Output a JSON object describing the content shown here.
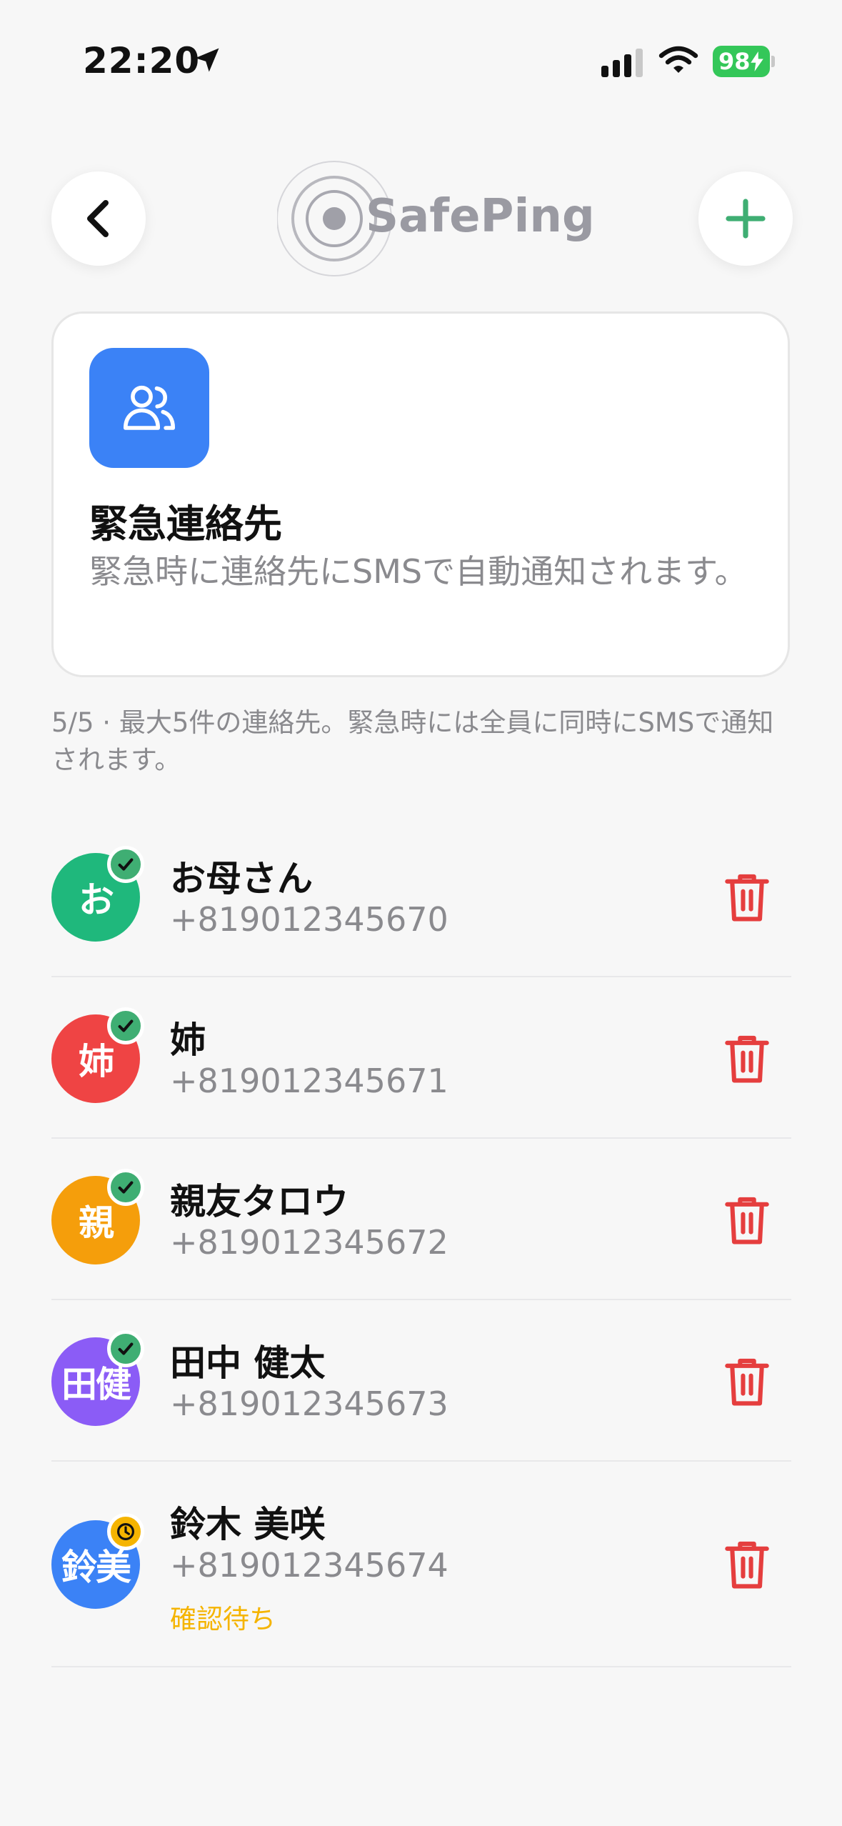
{
  "status_bar": {
    "time": "22:20",
    "battery": "98"
  },
  "header": {
    "logo_text": "SafePing"
  },
  "info_card": {
    "title": "緊急連絡先",
    "description": "緊急時に連絡先にSMSで自動通知されます。"
  },
  "summary": "5/5 · 最大5件の連絡先。緊急時には全員に同時にSMSで通知されます。",
  "contacts": [
    {
      "initial": "お",
      "name": "お母さん",
      "phone": "+819012345670",
      "color": "#1fb87c",
      "verified": true
    },
    {
      "initial": "姉",
      "name": "姉",
      "phone": "+819012345671",
      "color": "#ef4444",
      "verified": true
    },
    {
      "initial": "親",
      "name": "親友タロウ",
      "phone": "+819012345672",
      "color": "#f59e0b",
      "verified": true
    },
    {
      "initial": "田健",
      "name": "田中 健太",
      "phone": "+819012345673",
      "color": "#8b5cf6",
      "verified": true
    },
    {
      "initial": "鈴美",
      "name": "鈴木 美咲",
      "phone": "+819012345674",
      "color": "#3b82f6",
      "verified": false,
      "status": "確認待ち"
    }
  ],
  "colors": {
    "accent_green": "#3fae73",
    "delete_red": "#e53e3e",
    "pending_yellow": "#f5b400",
    "card_icon_blue": "#3b82f6"
  }
}
